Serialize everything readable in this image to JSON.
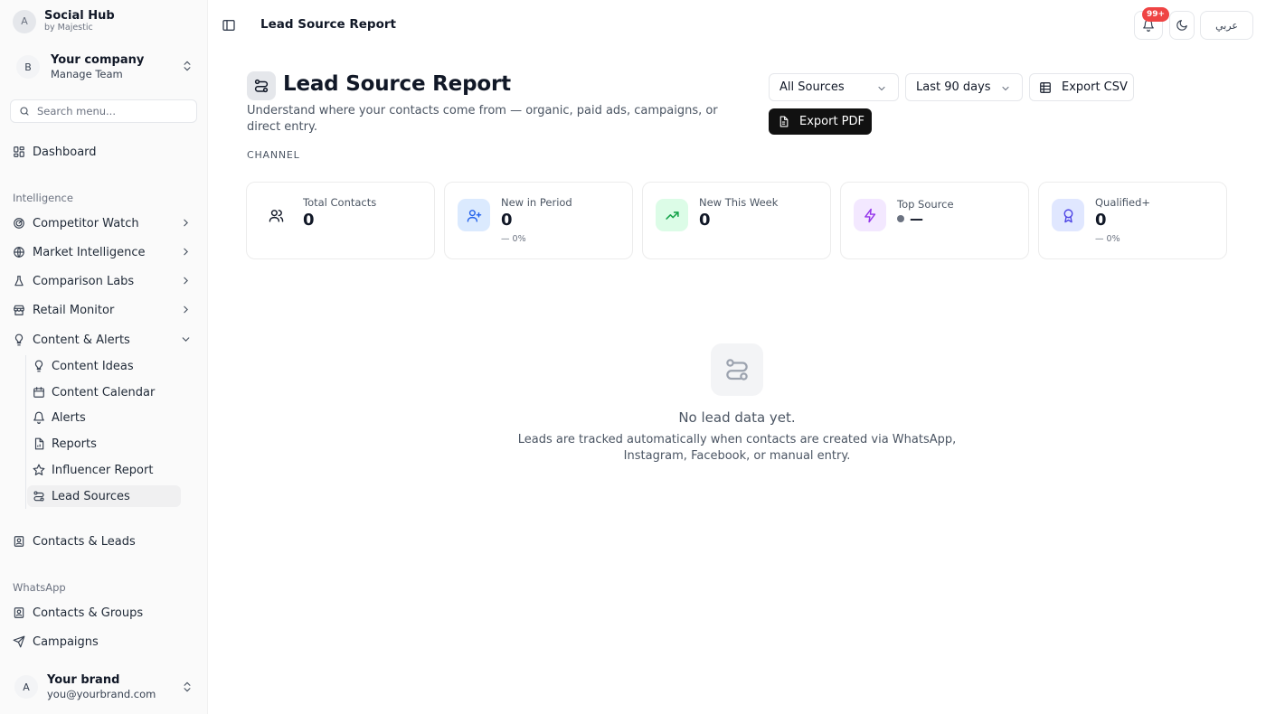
{
  "app": {
    "name": "Social Hub",
    "tagline": "by Majestic",
    "avatar_letter": "A"
  },
  "team": {
    "avatar_letter": "B",
    "name": "Your company",
    "subtitle": "Manage Team"
  },
  "search": {
    "placeholder": "Search menu..."
  },
  "sidebar": {
    "dashboard": "Dashboard",
    "intelligence_label": "Intelligence",
    "intelligence_items": [
      {
        "label": "Competitor Watch",
        "icon": "radar-icon"
      },
      {
        "label": "Market Intelligence",
        "icon": "globe-icon"
      },
      {
        "label": "Comparison Labs",
        "icon": "flask-icon"
      },
      {
        "label": "Retail Monitor",
        "icon": "store-icon"
      },
      {
        "label": "Content & Alerts",
        "icon": "lightbulb-icon"
      }
    ],
    "content_sub_items": [
      {
        "label": "Content Ideas",
        "icon": "lightbulb-icon"
      },
      {
        "label": "Content Calendar",
        "icon": "calendar-icon"
      },
      {
        "label": "Alerts",
        "icon": "bell-icon"
      },
      {
        "label": "Reports",
        "icon": "report-icon"
      },
      {
        "label": "Influencer Report",
        "icon": "star-icon"
      },
      {
        "label": "Lead Sources",
        "icon": "route-icon",
        "active": true
      }
    ],
    "contacts_leads": "Contacts & Leads",
    "whatsapp_label": "WhatsApp",
    "whatsapp_items": [
      {
        "label": "Contacts & Groups",
        "icon": "contact-book-icon"
      },
      {
        "label": "Campaigns",
        "icon": "send-icon"
      }
    ]
  },
  "user": {
    "avatar_letter": "A",
    "name": "Your brand",
    "email": "you@yourbrand.com"
  },
  "header": {
    "title": "Lead Source Report",
    "notifications_badge": "99+",
    "language_label": "عربي"
  },
  "page": {
    "title": "Lead Source Report",
    "description": "Understand where your contacts come from — organic, paid ads, campaigns, or direct entry.",
    "section_label": "CHANNEL",
    "source_filter": "All Sources",
    "period_filter": "Last 90 days",
    "export_csv": "Export CSV",
    "export_pdf": "Export PDF"
  },
  "stats": [
    {
      "label": "Total Contacts",
      "value": "0",
      "icon": "users-icon",
      "icon_bg": "#f3f4f6",
      "icon_color": "#111827"
    },
    {
      "label": "New in Period",
      "value": "0",
      "delta": "— 0%",
      "icon": "user-plus-icon",
      "icon_bg": "#dbeafe",
      "icon_color": "#2563eb"
    },
    {
      "label": "New This Week",
      "value": "0",
      "icon": "trending-up-icon",
      "icon_bg": "#dcfce7",
      "icon_color": "#16a34a"
    },
    {
      "label": "Top Source",
      "value": "—",
      "icon": "zap-icon",
      "icon_bg": "#f3e8ff",
      "icon_color": "#9333ea"
    },
    {
      "label": "Qualified+",
      "value": "0",
      "delta": "— 0%",
      "icon": "award-icon",
      "icon_bg": "#e0e7ff",
      "icon_color": "#4f46e5"
    }
  ],
  "empty_state": {
    "title": "No lead data yet.",
    "description": "Leads are tracked automatically when contacts are created via WhatsApp, Instagram, Facebook, or manual entry."
  }
}
